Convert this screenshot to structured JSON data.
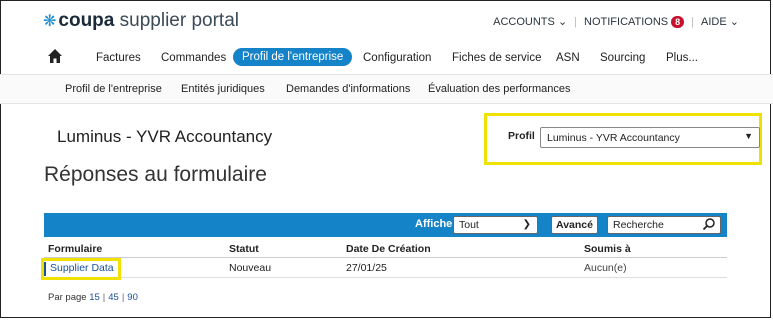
{
  "brand": {
    "coupa": "coupa",
    "rest": "supplier portal"
  },
  "top_links": {
    "accounts": "ACCOUNTS",
    "notifications": "NOTIFICATIONS",
    "notifications_count": "8",
    "help": "AIDE"
  },
  "nav": {
    "items": [
      "Factures",
      "Commandes",
      "Profil de l'entreprise",
      "Configuration",
      "Fiches de service",
      "ASN",
      "Sourcing",
      "Plus..."
    ],
    "active": "Profil de l'entreprise"
  },
  "subnav": {
    "items": [
      "Profil de l'entreprise",
      "Entités juridiques",
      "Demandes d'informations",
      "Évaluation des performances"
    ]
  },
  "company_name": "Luminus - YVR Accountancy",
  "profile": {
    "label": "Profil",
    "selected": "Luminus - YVR Accountancy"
  },
  "page_title": "Réponses au formulaire",
  "toolbar": {
    "show_label": "Afficher",
    "filter_value": "Tout",
    "advanced_label": "Avancé",
    "search_placeholder": "Recherche"
  },
  "table": {
    "columns": [
      "Formulaire",
      "Statut",
      "Date De Création",
      "Soumis à"
    ],
    "rows": [
      {
        "form": "Supplier Data",
        "status": "Nouveau",
        "created": "27/01/25",
        "submitted_to": "Aucun(e)"
      }
    ]
  },
  "pagination": {
    "label": "Par page",
    "options": [
      "15",
      "45",
      "90"
    ]
  },
  "colors": {
    "accent": "#1583c7",
    "highlight": "#f1e100",
    "badge": "#c8102e",
    "link": "#1a4f9c"
  }
}
